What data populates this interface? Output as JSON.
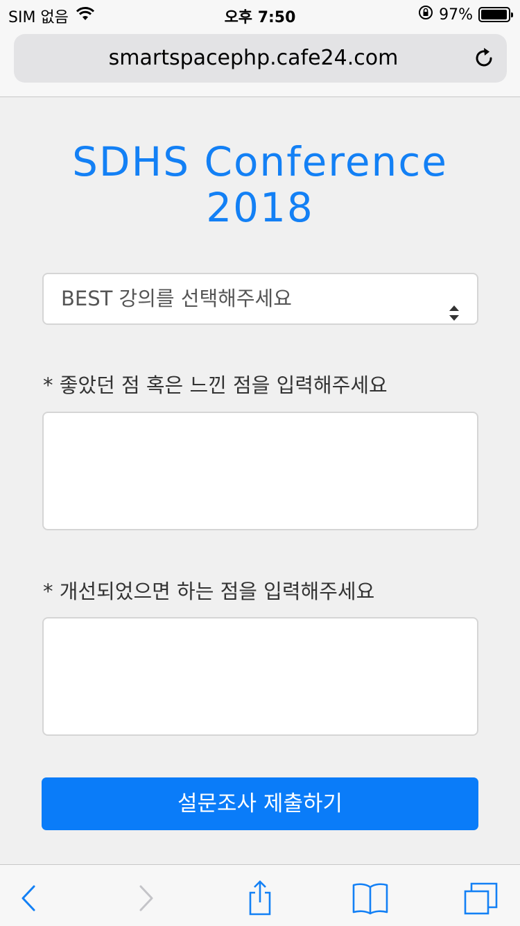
{
  "status_bar": {
    "carrier": "SIM 없음",
    "time": "오후 7:50",
    "battery": "97%",
    "battery_level": 0.97,
    "icons": [
      "wifi-icon",
      "orientation-lock-icon",
      "battery-icon"
    ]
  },
  "browser": {
    "url": "smartspacephp.cafe24.com",
    "icons": [
      "reload-icon",
      "back-icon",
      "forward-icon",
      "share-icon",
      "bookmarks-icon",
      "tabs-icon"
    ]
  },
  "page": {
    "title_line1": "SDHS Conference",
    "title_line2": "2018",
    "select_placeholder": "BEST 강의를 선택해주세요",
    "label_good": "* 좋았던 점 혹은 느낀 점을 입력해주세요",
    "label_improve": "* 개선되었으면 하는 점을 입력해주세요",
    "submit_label": "설문조사 제출하기"
  },
  "colors": {
    "accent": "#0a7cf9",
    "title": "#1380f5",
    "toolbar_icon": "#1380f5",
    "background": "#f0f0f0"
  }
}
